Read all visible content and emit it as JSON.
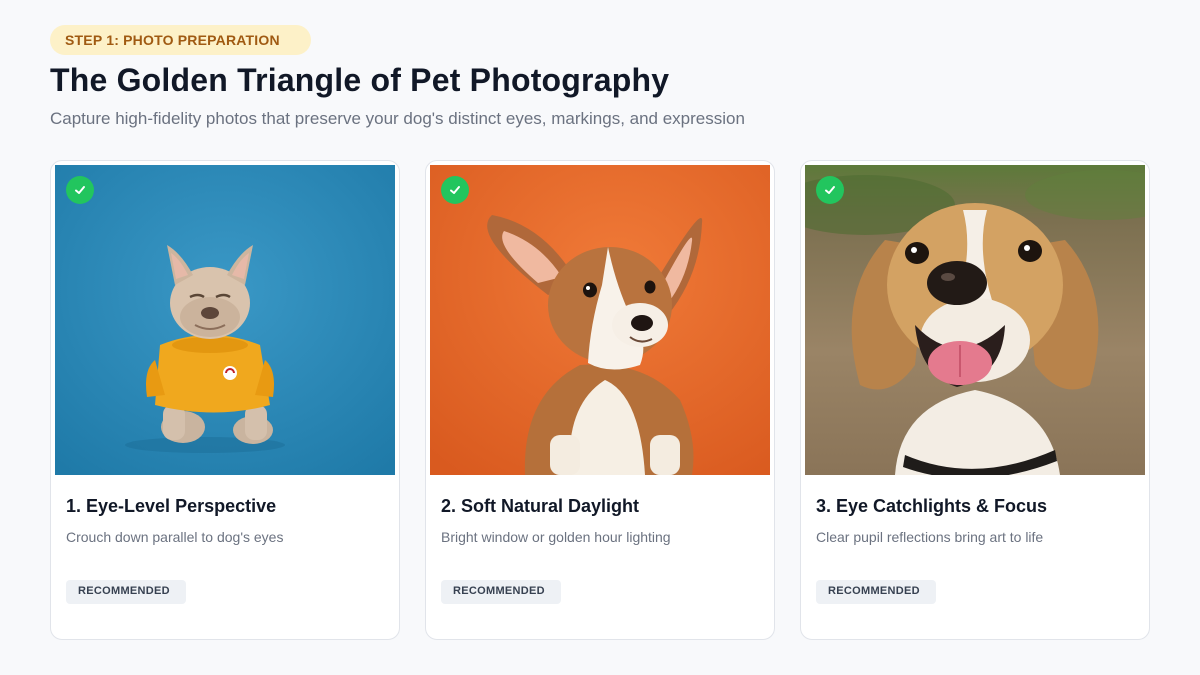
{
  "header": {
    "step_badge": "STEP 1: PHOTO PREPARATION",
    "title": "The Golden Triangle of Pet Photography",
    "subtitle": "Capture high-fidelity photos that preserve your dog's distinct eyes, markings, and expression"
  },
  "cards": [
    {
      "title": "1. Eye-Level Perspective",
      "description": "Crouch down parallel to dog's eyes",
      "tag": "RECOMMENDED",
      "status_icon": "check-icon",
      "photo_background": "#2f8ab8",
      "photo_subject": "French bulldog in yellow sweater"
    },
    {
      "title": "2. Soft Natural Daylight",
      "description": "Bright window or golden hour lighting",
      "tag": "RECOMMENDED",
      "status_icon": "check-icon",
      "photo_background": "#e8692c",
      "photo_subject": "Corgi puppy"
    },
    {
      "title": "3. Eye Catchlights & Focus",
      "description": "Clear pupil reflections bring art to life",
      "tag": "RECOMMENDED",
      "status_icon": "check-icon",
      "photo_background": "#8a7a5a",
      "photo_subject": "Smiling beagle"
    }
  ],
  "colors": {
    "badge_bg": "#fdf1c8",
    "badge_text": "#a05a12",
    "check_green": "#22c55e",
    "title_text": "#111827",
    "muted_text": "#6b7280",
    "tag_bg": "#eef1f5"
  }
}
